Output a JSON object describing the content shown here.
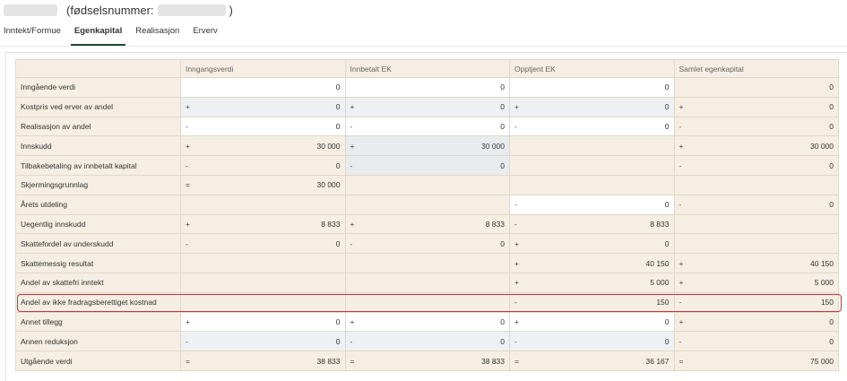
{
  "header": {
    "ssn_label": "(fødselsnummer:",
    "ssn_close": ")"
  },
  "tabs": [
    {
      "label": "Inntekt/Formue",
      "active": false
    },
    {
      "label": "Egenkapital",
      "active": true
    },
    {
      "label": "Realisasjon",
      "active": false
    },
    {
      "label": "Erverv",
      "active": false
    }
  ],
  "table": {
    "columns": [
      "",
      "Inngangsverdi",
      "Innbetalt EK",
      "Opptjent EK",
      "Samlet egenkapital"
    ],
    "rows": [
      {
        "label": "Inngående verdi",
        "cells": [
          {
            "sign": "",
            "value": "0",
            "style": "input"
          },
          {
            "sign": "",
            "value": "0",
            "style": "input"
          },
          {
            "sign": "",
            "value": "0",
            "style": "input"
          },
          {
            "sign": "",
            "value": "0",
            "style": "plain"
          }
        ]
      },
      {
        "label": "Kostpris ved erver av andel",
        "cells": [
          {
            "sign": "+",
            "value": "0",
            "style": "shade"
          },
          {
            "sign": "+",
            "value": "0",
            "style": "shade"
          },
          {
            "sign": "+",
            "value": "0",
            "style": "shade"
          },
          {
            "sign": "+",
            "value": "0",
            "style": "plain"
          }
        ]
      },
      {
        "label": "Realisasjon av andel",
        "cells": [
          {
            "sign": "-",
            "value": "0",
            "style": "input"
          },
          {
            "sign": "-",
            "value": "0",
            "style": "input"
          },
          {
            "sign": "-",
            "value": "0",
            "style": "input"
          },
          {
            "sign": "-",
            "value": "0",
            "style": "plain"
          }
        ]
      },
      {
        "label": "Innskudd",
        "cells": [
          {
            "sign": "+",
            "value": "30 000",
            "style": "plain"
          },
          {
            "sign": "+",
            "value": "30 000",
            "style": "gray"
          },
          {
            "sign": "",
            "value": "",
            "style": "empty"
          },
          {
            "sign": "+",
            "value": "30 000",
            "style": "plain"
          }
        ]
      },
      {
        "label": "Tilbakebetaling av innbetalt kapital",
        "cells": [
          {
            "sign": "-",
            "value": "0",
            "style": "plain"
          },
          {
            "sign": "-",
            "value": "0",
            "style": "gray"
          },
          {
            "sign": "",
            "value": "",
            "style": "empty"
          },
          {
            "sign": "-",
            "value": "0",
            "style": "plain"
          }
        ]
      },
      {
        "label": "Skjermingsgrunnlag",
        "cells": [
          {
            "sign": "=",
            "value": "30 000",
            "style": "plain"
          },
          {
            "sign": "",
            "value": "",
            "style": "empty"
          },
          {
            "sign": "",
            "value": "",
            "style": "empty"
          },
          {
            "sign": "",
            "value": "",
            "style": "empty"
          }
        ]
      },
      {
        "label": "Årets utdeling",
        "cells": [
          {
            "sign": "",
            "value": "",
            "style": "empty"
          },
          {
            "sign": "",
            "value": "",
            "style": "empty"
          },
          {
            "sign": "-",
            "value": "0",
            "style": "input"
          },
          {
            "sign": "-",
            "value": "0",
            "style": "plain"
          }
        ]
      },
      {
        "label": "Uegentlig innskudd",
        "cells": [
          {
            "sign": "+",
            "value": "8 833",
            "style": "plain"
          },
          {
            "sign": "+",
            "value": "8 833",
            "style": "plain"
          },
          {
            "sign": "-",
            "value": "8 833",
            "style": "plain"
          },
          {
            "sign": "",
            "value": "",
            "style": "empty"
          }
        ]
      },
      {
        "label": "Skattefordel av underskudd",
        "cells": [
          {
            "sign": "-",
            "value": "0",
            "style": "plain"
          },
          {
            "sign": "-",
            "value": "0",
            "style": "plain"
          },
          {
            "sign": "+",
            "value": "0",
            "style": "plain"
          },
          {
            "sign": "",
            "value": "",
            "style": "empty"
          }
        ]
      },
      {
        "label": "Skattemessig resultat",
        "cells": [
          {
            "sign": "",
            "value": "",
            "style": "empty"
          },
          {
            "sign": "",
            "value": "",
            "style": "empty"
          },
          {
            "sign": "+",
            "value": "40 150",
            "style": "plain"
          },
          {
            "sign": "+",
            "value": "40 150",
            "style": "plain"
          }
        ]
      },
      {
        "label": "Andel av skattefri inntekt",
        "cells": [
          {
            "sign": "",
            "value": "",
            "style": "empty"
          },
          {
            "sign": "",
            "value": "",
            "style": "empty"
          },
          {
            "sign": "+",
            "value": "5 000",
            "style": "plain"
          },
          {
            "sign": "+",
            "value": "5 000",
            "style": "plain"
          }
        ]
      },
      {
        "label": "Andel av ikke fradragsberettiget kostnad",
        "cells": [
          {
            "sign": "",
            "value": "",
            "style": "empty"
          },
          {
            "sign": "",
            "value": "",
            "style": "empty"
          },
          {
            "sign": "-",
            "value": "150",
            "style": "plain"
          },
          {
            "sign": "-",
            "value": "150",
            "style": "plain"
          }
        ]
      },
      {
        "label": "Annet tillegg",
        "cells": [
          {
            "sign": "+",
            "value": "0",
            "style": "input"
          },
          {
            "sign": "+",
            "value": "0",
            "style": "input"
          },
          {
            "sign": "+",
            "value": "0",
            "style": "input"
          },
          {
            "sign": "+",
            "value": "0",
            "style": "plain"
          }
        ]
      },
      {
        "label": "Annen reduksjon",
        "cells": [
          {
            "sign": "-",
            "value": "0",
            "style": "shade"
          },
          {
            "sign": "-",
            "value": "0",
            "style": "shade"
          },
          {
            "sign": "-",
            "value": "0",
            "style": "shade"
          },
          {
            "sign": "-",
            "value": "0",
            "style": "plain"
          }
        ]
      },
      {
        "label": "Utgående verdi",
        "cells": [
          {
            "sign": "=",
            "value": "38 833",
            "style": "plain"
          },
          {
            "sign": "=",
            "value": "38 833",
            "style": "plain"
          },
          {
            "sign": "=",
            "value": "36 167",
            "style": "plain"
          },
          {
            "sign": "=",
            "value": "75 000",
            "style": "plain"
          }
        ]
      }
    ]
  },
  "colors": {
    "header_bg": "#f6eee2",
    "input_bg": "#ffffff",
    "shade_bg": "#edf1f3",
    "active_tab_underline": "#1f4a34",
    "highlight_border": "#c8323c"
  }
}
